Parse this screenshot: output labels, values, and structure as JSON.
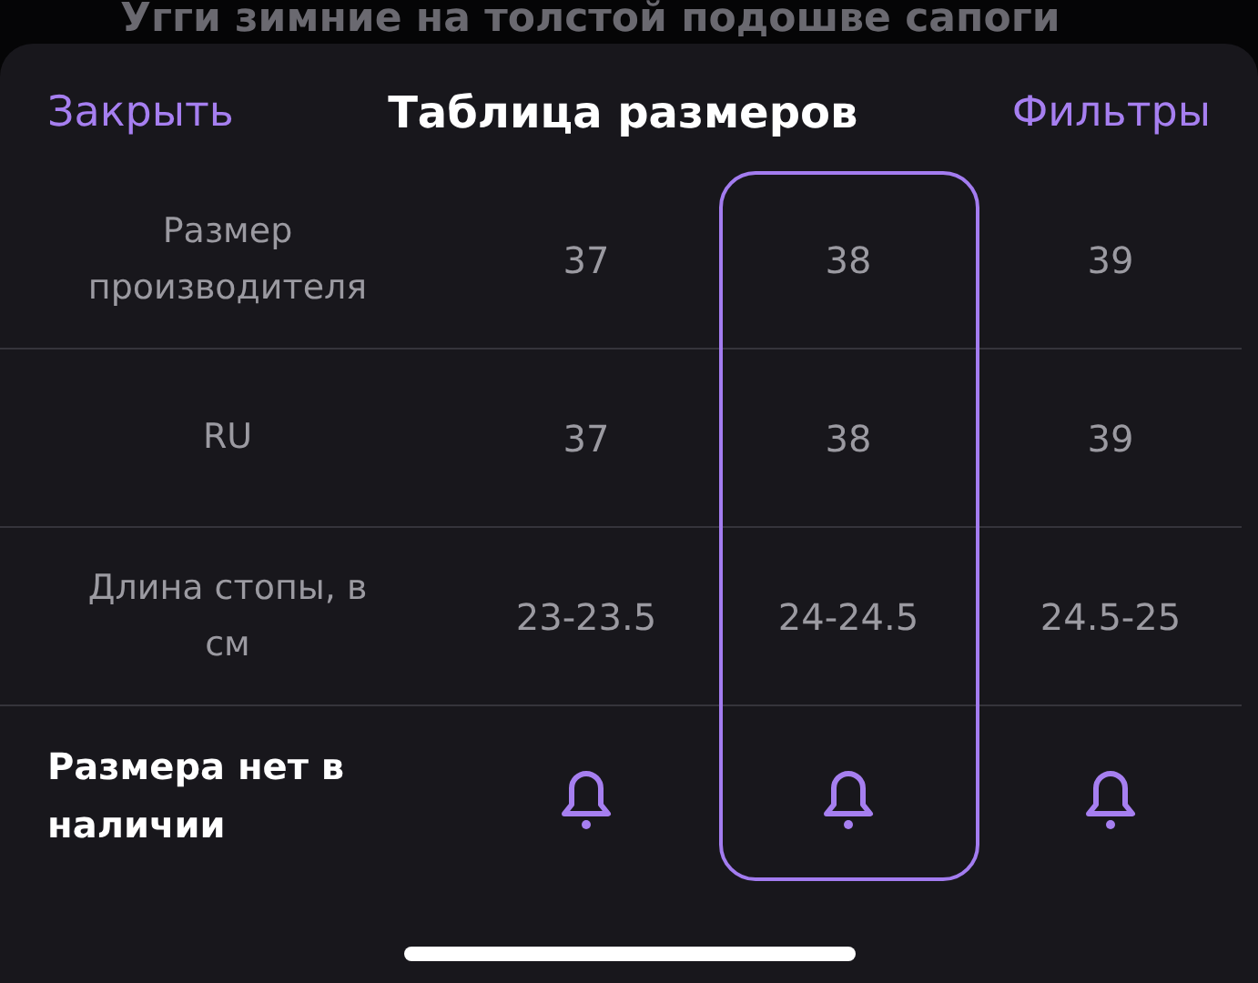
{
  "background_title": "Угги зимние на толстой подошве сапоги",
  "header": {
    "close": "Закрыть",
    "title": "Таблица размеров",
    "filters": "Фильтры"
  },
  "columns": [
    {
      "selected": false
    },
    {
      "selected": true
    },
    {
      "selected": false
    }
  ],
  "rows": [
    {
      "kind": "text",
      "label": "Размер производителя",
      "values": [
        "37",
        "38",
        "39"
      ]
    },
    {
      "kind": "text",
      "label": "RU",
      "values": [
        "37",
        "38",
        "39"
      ]
    },
    {
      "kind": "text",
      "label": "Длина стопы, в см",
      "values": [
        "23-23.5",
        "24-24.5",
        "24.5-25"
      ]
    },
    {
      "kind": "availability",
      "label": "Размера нет в наличии"
    }
  ]
}
